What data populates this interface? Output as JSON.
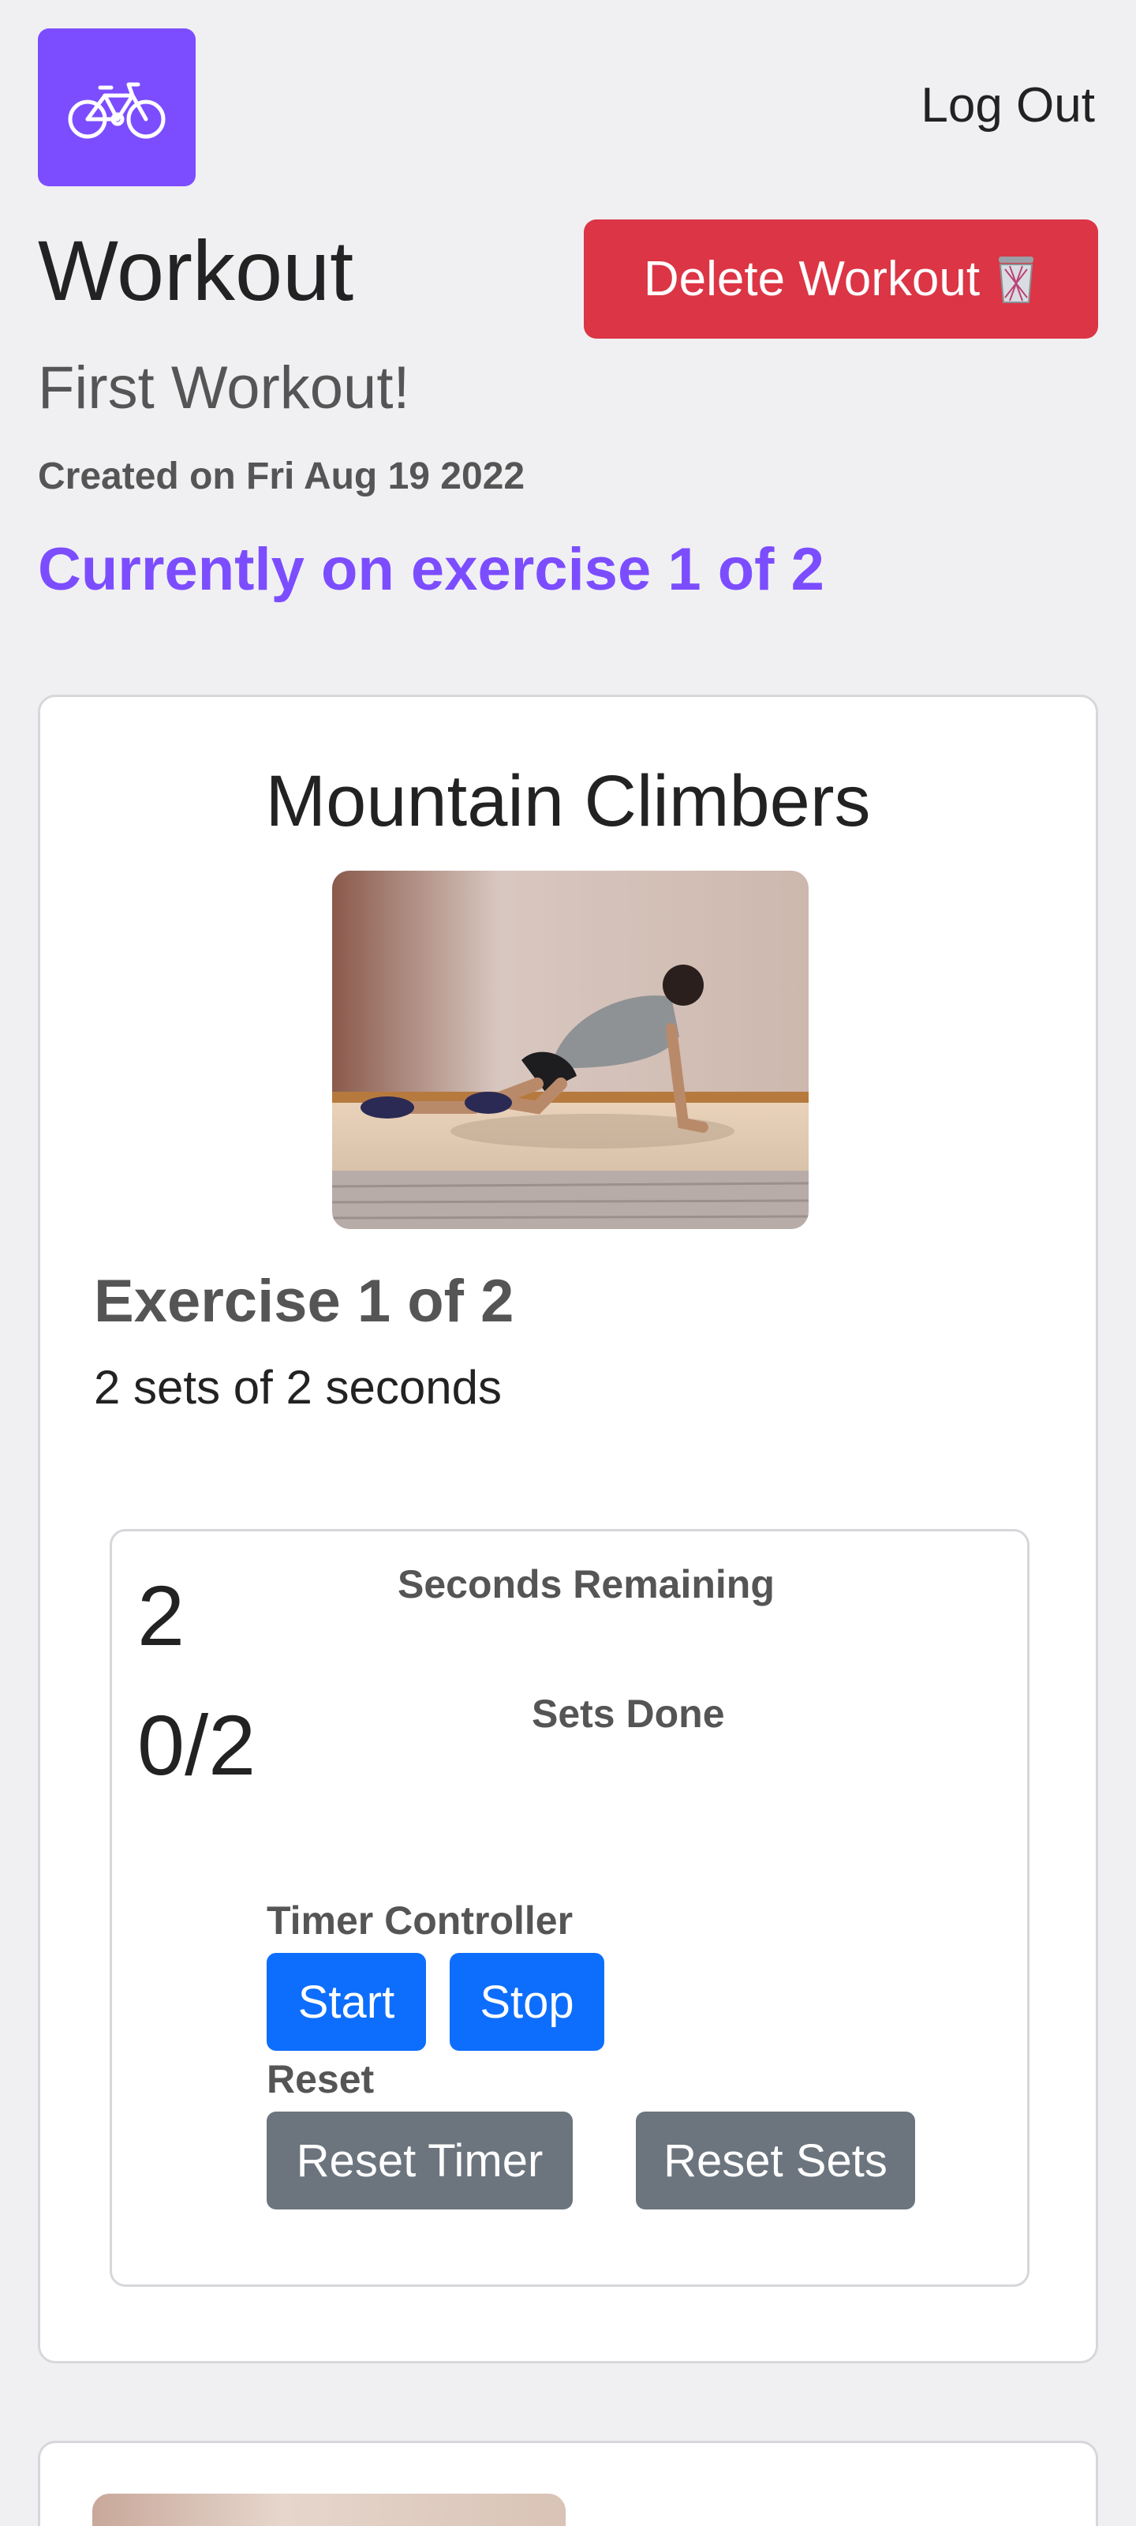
{
  "header": {
    "logo_icon": "bicycle-icon",
    "logo_color": "#7c4dff",
    "logout_label": "Log Out"
  },
  "workout": {
    "title": "Workout",
    "delete_label": "Delete Workout",
    "delete_icon": "trash-icon",
    "name": "First Workout!",
    "created": "Created on Fri Aug 19 2022",
    "progress": "Currently on exercise 1 of 2"
  },
  "exercise": {
    "name": "Mountain Climbers",
    "count_label": "Exercise 1 of 2",
    "description": "2 sets of 2 seconds"
  },
  "timer": {
    "seconds_value": "2",
    "seconds_label": "Seconds Remaining",
    "sets_value": "0/2",
    "sets_label": "Sets Done",
    "controller_label": "Timer Controller",
    "start_label": "Start",
    "stop_label": "Stop",
    "reset_label": "Reset",
    "reset_timer_label": "Reset Timer",
    "reset_sets_label": "Reset Sets"
  },
  "colors": {
    "accent": "#7c4dff",
    "danger": "#dc3545",
    "primary": "#0d6efd",
    "secondary": "#6c757d"
  }
}
